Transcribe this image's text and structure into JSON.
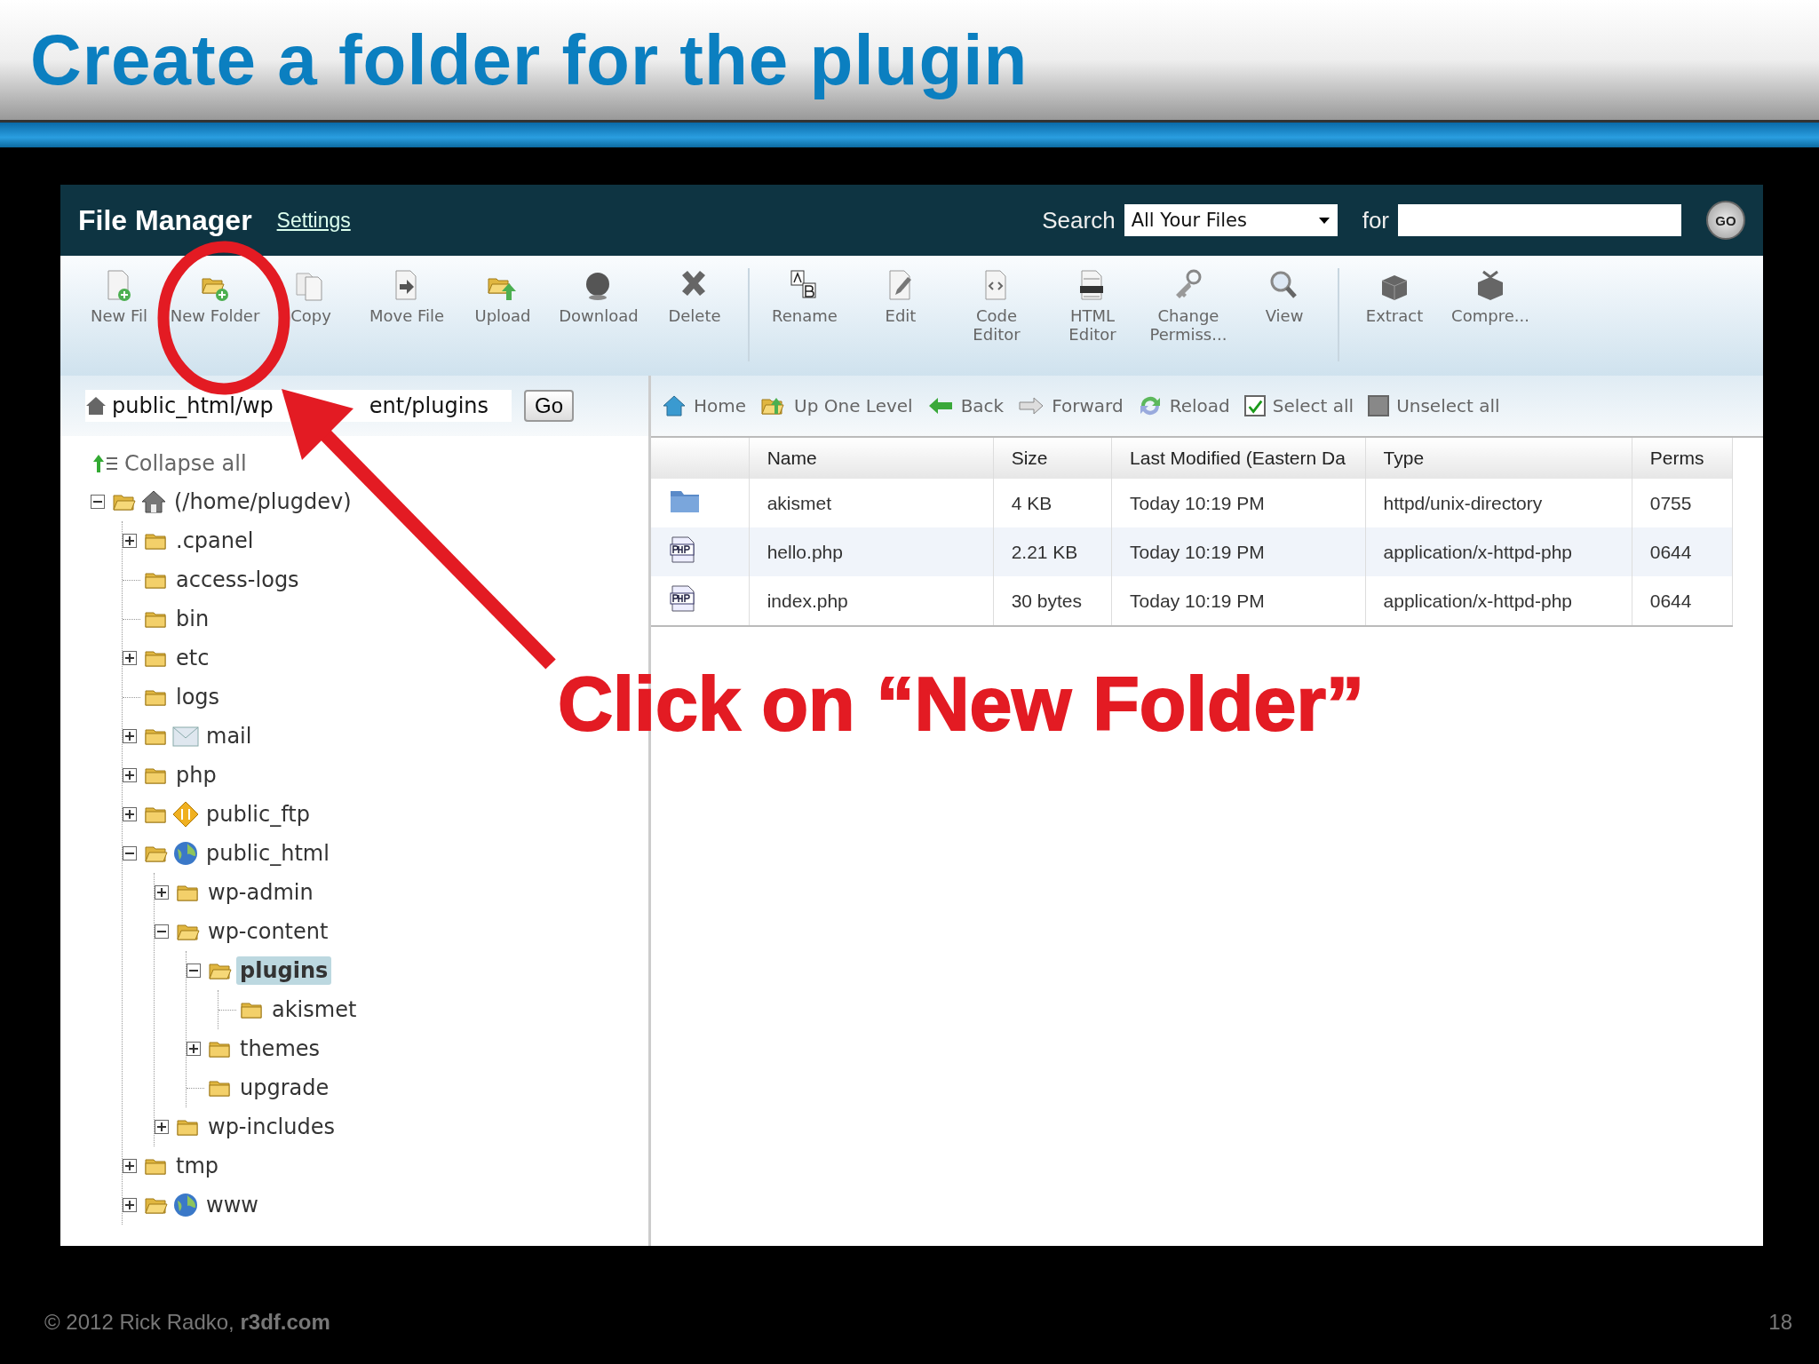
{
  "slide": {
    "title": "Create a folder for the plugin",
    "footer": "© 2012  Rick Radko, **r3df.com**",
    "page": "18"
  },
  "file_manager": {
    "title": "File Manager",
    "settings_link": "Settings",
    "search_label": "Search",
    "search_scope": "All Your Files",
    "for_label": "for",
    "go_button": "GO",
    "toolbar": [
      [
        {
          "kind": "new-file",
          "label": "New Fil"
        },
        {
          "kind": "new-folder",
          "label": "New Folder"
        },
        {
          "kind": "copy",
          "label": "Copy"
        },
        {
          "kind": "move",
          "label": "Move File"
        },
        {
          "kind": "upload",
          "label": "Upload"
        },
        {
          "kind": "download",
          "label": "Download"
        },
        {
          "kind": "delete",
          "label": "Delete"
        }
      ],
      [
        {
          "kind": "rename",
          "label": "Rename"
        },
        {
          "kind": "edit",
          "label": "Edit"
        },
        {
          "kind": "code",
          "label": "Code Editor"
        },
        {
          "kind": "html",
          "label": "HTML Editor"
        },
        {
          "kind": "perms",
          "label": "Change Permiss..."
        },
        {
          "kind": "view",
          "label": "View"
        }
      ],
      [
        {
          "kind": "extract",
          "label": "Extract"
        },
        {
          "kind": "compress",
          "label": "Compre..."
        }
      ]
    ],
    "path": {
      "visible_parts": [
        "public_html/wp",
        "ent/plugins"
      ],
      "go": "Go"
    },
    "collapse_all": "Collapse all",
    "tree": [
      {
        "label": "(/home/plugdev)",
        "kind": "home",
        "expanded": true,
        "selected": false,
        "children": [
          {
            "label": ".cpanel",
            "kind": "folder",
            "expanded": false,
            "selected": false
          },
          {
            "label": "access-logs",
            "kind": "folder",
            "selected": false
          },
          {
            "label": "bin",
            "kind": "folder",
            "selected": false
          },
          {
            "label": "etc",
            "kind": "folder",
            "expanded": false,
            "selected": false
          },
          {
            "label": "logs",
            "kind": "folder",
            "selected": false
          },
          {
            "label": "mail",
            "kind": "mail",
            "expanded": false,
            "selected": false
          },
          {
            "label": "php",
            "kind": "folder",
            "expanded": false,
            "selected": false
          },
          {
            "label": "public_ftp",
            "kind": "ftp",
            "expanded": false,
            "selected": false
          },
          {
            "label": "public_html",
            "kind": "globe",
            "expanded": true,
            "selected": false,
            "children": [
              {
                "label": "wp-admin",
                "kind": "folder",
                "expanded": false,
                "selected": false
              },
              {
                "label": "wp-content",
                "kind": "open",
                "expanded": true,
                "selected": false,
                "children": [
                  {
                    "label": "plugins",
                    "kind": "open",
                    "expanded": true,
                    "selected": true,
                    "children": [
                      {
                        "label": "akismet",
                        "kind": "folder",
                        "selected": false
                      }
                    ]
                  },
                  {
                    "label": "themes",
                    "kind": "folder",
                    "expanded": false,
                    "selected": false
                  },
                  {
                    "label": "upgrade",
                    "kind": "folder",
                    "selected": false
                  }
                ]
              },
              {
                "label": "wp-includes",
                "kind": "folder",
                "expanded": false,
                "selected": false
              }
            ]
          },
          {
            "label": "tmp",
            "kind": "folder",
            "expanded": false,
            "selected": false
          },
          {
            "label": "www",
            "kind": "globe",
            "expanded": false,
            "selected": false
          }
        ]
      }
    ],
    "nav": [
      {
        "kind": "home",
        "label": "Home"
      },
      {
        "kind": "up",
        "label": "Up One Level"
      },
      {
        "kind": "back",
        "label": "Back"
      },
      {
        "kind": "forward",
        "label": "Forward"
      },
      {
        "kind": "reload",
        "label": "Reload"
      },
      {
        "kind": "check",
        "label": "Select all",
        "checked": true
      },
      {
        "kind": "check",
        "label": "Unselect all",
        "checked": false
      }
    ],
    "table": {
      "columns": [
        "Name",
        "Size",
        "Last Modified (Eastern Da",
        "Type",
        "Perms"
      ],
      "rows": [
        {
          "kind": "folder",
          "cells": [
            "akismet",
            "4 KB",
            "Today 10:19 PM",
            "httpd/unix-directory",
            "0755"
          ]
        },
        {
          "kind": "php",
          "cells": [
            "hello.php",
            "2.21 KB",
            "Today 10:19 PM",
            "application/x-httpd-php",
            "0644"
          ]
        },
        {
          "kind": "php",
          "cells": [
            "index.php",
            "30 bytes",
            "Today 10:19 PM",
            "application/x-httpd-php",
            "0644"
          ]
        }
      ]
    }
  },
  "annotation": {
    "text": "Click on “New Folder”"
  }
}
